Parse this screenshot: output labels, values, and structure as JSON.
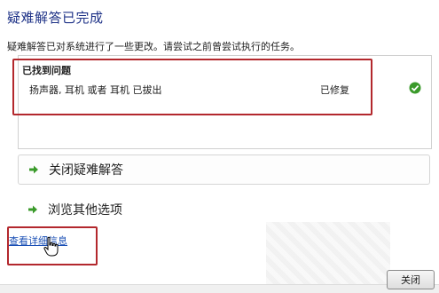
{
  "title": "疑难解答已完成",
  "description": "疑难解答已对系统进行了一些更改。请尝试之前曾尝试执行的任务。",
  "results": {
    "header": "已找到问题",
    "items": [
      {
        "name": "扬声器, 耳机 或者 耳机 已拔出",
        "status": "已修复",
        "icon": "check-icon"
      }
    ]
  },
  "actions": {
    "close_troubleshooter": "关闭疑难解答",
    "browse_options": "浏览其他选项"
  },
  "details_link": "查看详细信息",
  "footer": {
    "close_button": "关闭"
  },
  "colors": {
    "title": "#1e3287",
    "link": "#1a4fb5",
    "highlight": "#b3282d",
    "success": "#3a9a2a"
  }
}
